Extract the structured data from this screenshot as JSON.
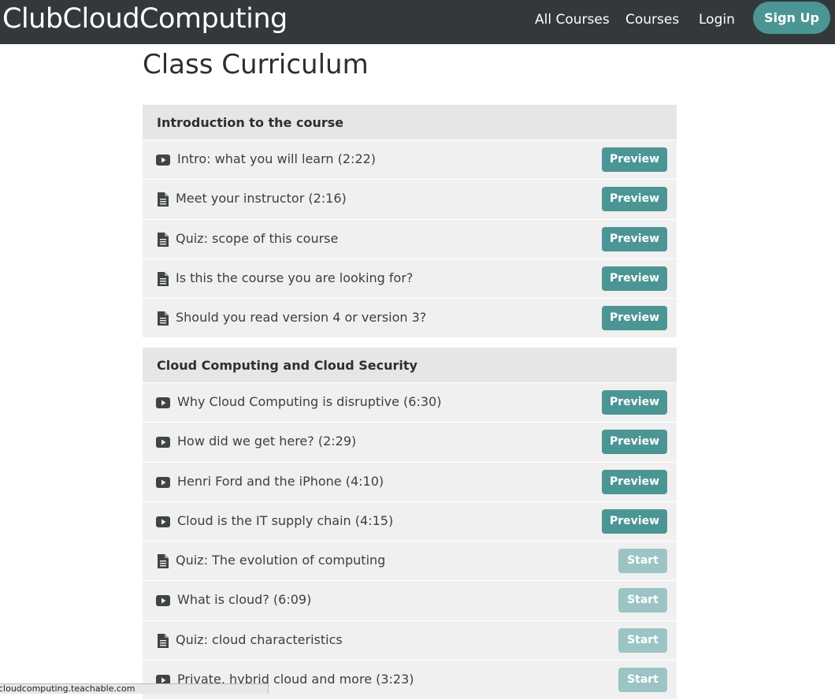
{
  "nav": {
    "brand": "ClubCloudComputing",
    "links": [
      "All Courses",
      "Courses",
      "Login"
    ],
    "signup": "Sign Up"
  },
  "page": {
    "title": "Class Curriculum"
  },
  "sections": [
    {
      "title": "Introduction to the course",
      "lectures": [
        {
          "icon": "video-icon",
          "title": "Intro: what you will learn (2:22)",
          "action": "Preview"
        },
        {
          "icon": "document-icon",
          "title": "Meet your instructor (2:16)",
          "action": "Preview"
        },
        {
          "icon": "document-icon",
          "title": "Quiz: scope of this course",
          "action": "Preview"
        },
        {
          "icon": "document-icon",
          "title": "Is this the course you are looking for?",
          "action": "Preview"
        },
        {
          "icon": "document-icon",
          "title": "Should you read version 4 or version 3?",
          "action": "Preview"
        }
      ]
    },
    {
      "title": "Cloud Computing and Cloud Security",
      "lectures": [
        {
          "icon": "video-icon",
          "title": "Why Cloud Computing is disruptive (6:30)",
          "action": "Preview"
        },
        {
          "icon": "video-icon",
          "title": "How did we get here? (2:29)",
          "action": "Preview"
        },
        {
          "icon": "video-icon",
          "title": "Henri Ford and the iPhone (4:10)",
          "action": "Preview"
        },
        {
          "icon": "video-icon",
          "title": "Cloud is the IT supply chain (4:15)",
          "action": "Preview"
        },
        {
          "icon": "document-icon",
          "title": "Quiz: The evolution of computing",
          "action": "Start"
        },
        {
          "icon": "video-icon",
          "title": "What is cloud? (6:09)",
          "action": "Start"
        },
        {
          "icon": "document-icon",
          "title": "Quiz: cloud characteristics",
          "action": "Start"
        },
        {
          "icon": "video-icon",
          "title": "Private, hybrid cloud and more (3:23)",
          "action": "Start"
        }
      ]
    }
  ],
  "status_bar": {
    "url": "cloudcomputing.teachable.com"
  }
}
